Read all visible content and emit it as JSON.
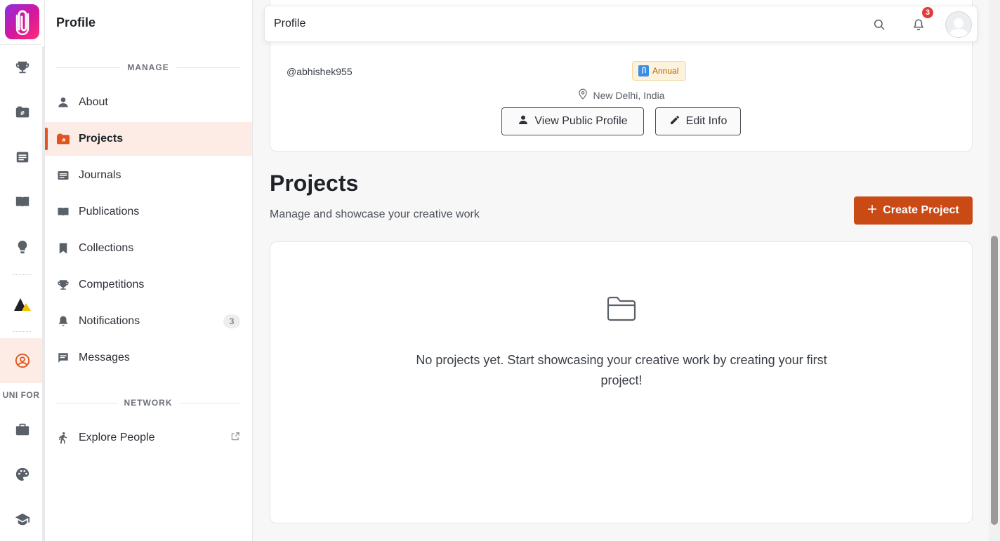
{
  "app": {
    "title": "Profile"
  },
  "rail": {
    "label": "UNI FOR"
  },
  "sidebar": {
    "title": "Profile",
    "section_manage": "MANAGE",
    "section_network": "NETWORK",
    "items": [
      {
        "label": "About",
        "icon": "person-icon"
      },
      {
        "label": "Projects",
        "icon": "projects-icon",
        "active": true
      },
      {
        "label": "Journals",
        "icon": "journal-icon"
      },
      {
        "label": "Publications",
        "icon": "book-icon"
      },
      {
        "label": "Collections",
        "icon": "bookmark-icon"
      },
      {
        "label": "Competitions",
        "icon": "trophy-icon"
      },
      {
        "label": "Notifications",
        "icon": "bell-icon",
        "count": "3"
      },
      {
        "label": "Messages",
        "icon": "message-icon"
      }
    ],
    "network_items": [
      {
        "label": "Explore People",
        "icon": "walking-person-icon"
      }
    ]
  },
  "topbar": {
    "breadcrumb": "Profile",
    "notification_count": "3"
  },
  "profile": {
    "username": "@abhishek955",
    "plan": "Annual",
    "location": "New Delhi, India",
    "view_public_label": "View Public Profile",
    "edit_label": "Edit Info"
  },
  "projects": {
    "heading": "Projects",
    "subheading": "Manage and showcase your creative work",
    "create_label": "Create Project",
    "empty_message": "No projects yet. Start showcasing your creative work by creating your first project!"
  },
  "colors": {
    "accent": "#e2541f",
    "create_button": "#c94a14",
    "active_bg": "#fdece6"
  }
}
